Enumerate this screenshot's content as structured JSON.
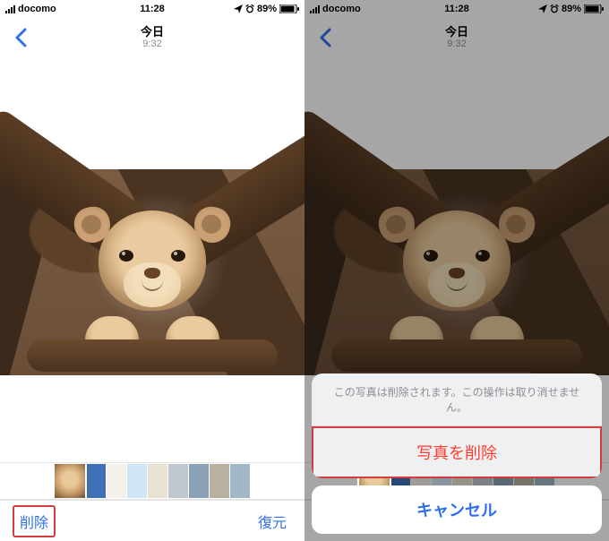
{
  "status": {
    "carrier": "docomo",
    "clock": "11:28",
    "battery_percent": "89%"
  },
  "nav": {
    "day_label": "今日",
    "time_label": "9:32"
  },
  "toolbar": {
    "delete_label": "削除",
    "recover_label": "復元"
  },
  "action_sheet": {
    "message": "この写真は削除されます。この操作は取り消せません。",
    "delete_label": "写真を削除",
    "cancel_label": "キャンセル"
  }
}
